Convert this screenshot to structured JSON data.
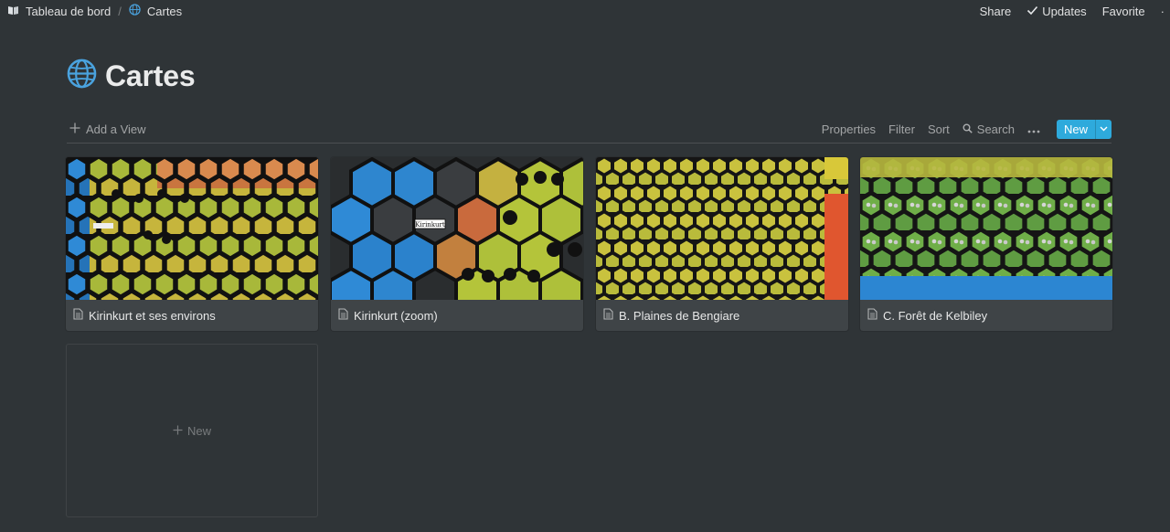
{
  "breadcrumb": {
    "parent": "Tableau de bord",
    "current": "Cartes"
  },
  "top_actions": {
    "share": "Share",
    "updates": "Updates",
    "favorite": "Favorite"
  },
  "page": {
    "title": "Cartes",
    "icon": "globe-icon"
  },
  "view_toolbar": {
    "add_view": "Add a View",
    "properties": "Properties",
    "filter": "Filter",
    "sort": "Sort",
    "search": "Search",
    "new": "New"
  },
  "colors": {
    "background": "#2f3437",
    "card": "#3f4447",
    "accent": "#2eaadc"
  },
  "gallery": {
    "cards": [
      {
        "title": "Kirinkurt et ses environs",
        "cover": "hex-map-overview"
      },
      {
        "title": "Kirinkurt (zoom)",
        "cover": "hex-map-zoom",
        "map_label": "Kirinkurt"
      },
      {
        "title": "B. Plaines de Bengiare",
        "cover": "hex-map-plains"
      },
      {
        "title": "C. Forêt de Kelbiley",
        "cover": "hex-map-forest"
      }
    ],
    "new_label": "New"
  }
}
